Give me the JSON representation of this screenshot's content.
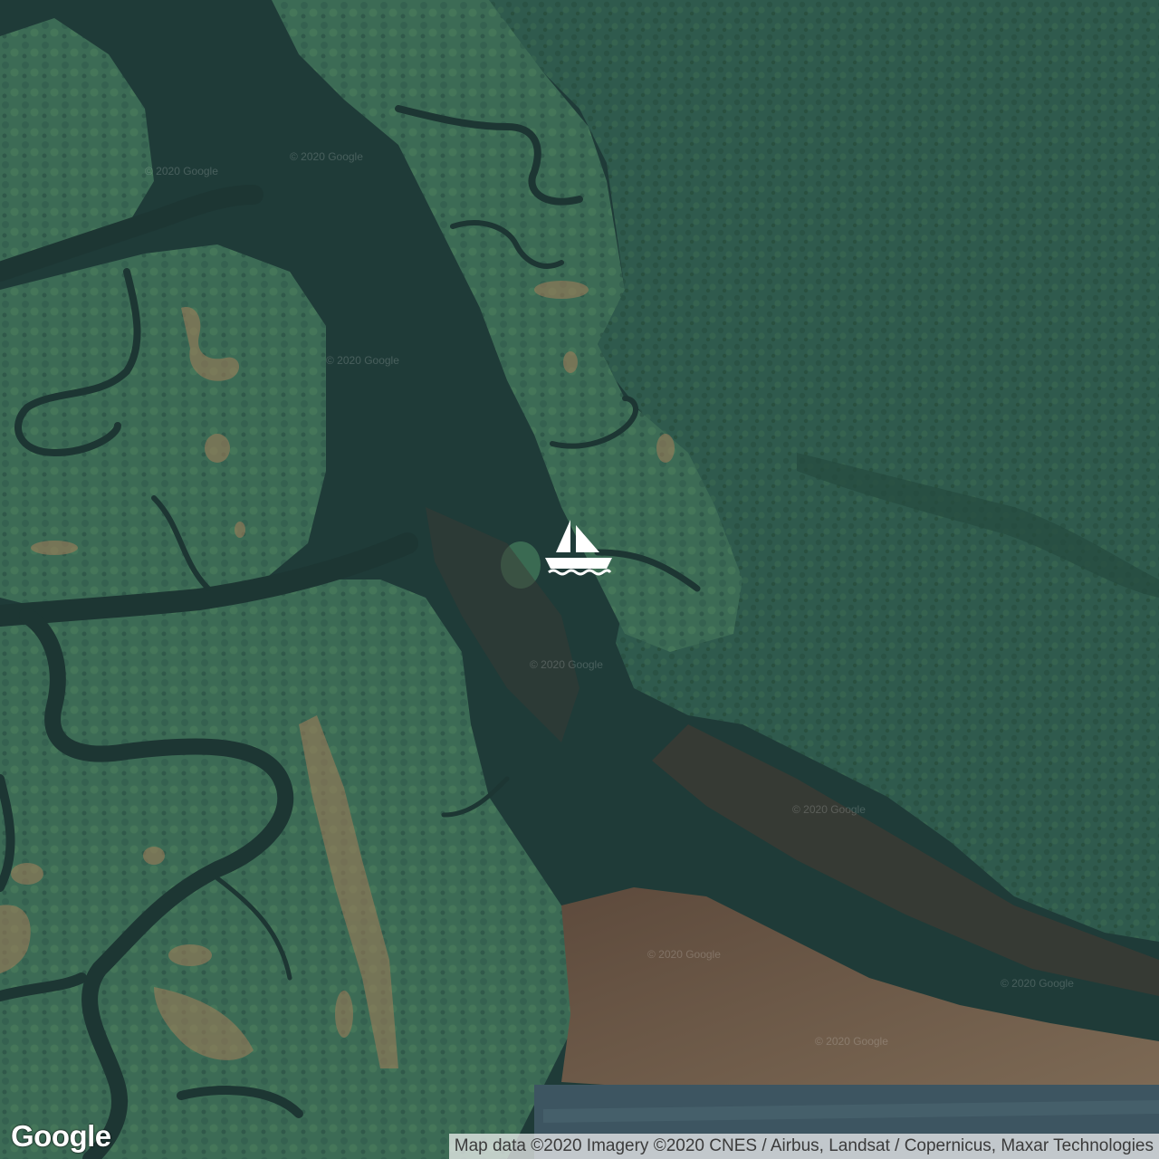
{
  "map": {
    "type": "satellite",
    "marker_icon": "sailboat-icon",
    "logo_text": "Google",
    "attribution": "Map data ©2020 Imagery ©2020 CNES / Airbus, Landsat / Copernicus, Maxar Technologies",
    "watermark_text": "© 2020 Google",
    "colors": {
      "forest": "#2f5a4d",
      "mangrove": "#3c6b55",
      "water": "#1f3b38",
      "mudflat": "#6b5a48",
      "marker": "#ffffff"
    }
  }
}
